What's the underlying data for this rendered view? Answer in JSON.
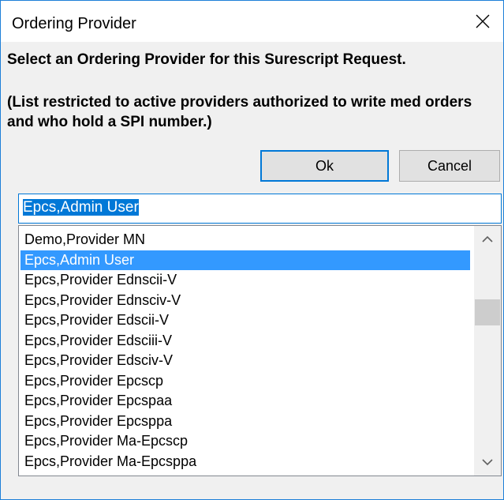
{
  "window": {
    "title": "Ordering Provider",
    "close_icon": "close-icon"
  },
  "prompt": "Select an Ordering Provider for this Surescript Request.",
  "note": "(List restricted to active providers authorized to write med orders and who hold a SPI number.)",
  "buttons": {
    "ok": "Ok",
    "cancel": "Cancel"
  },
  "search": {
    "value": "Epcs,Admin User"
  },
  "providers": [
    "Demo,Provider MN",
    "Epcs,Admin User",
    "Epcs,Provider Ednscii-V",
    "Epcs,Provider Ednsciv-V",
    "Epcs,Provider Edscii-V",
    "Epcs,Provider Edsciii-V",
    "Epcs,Provider Edsciv-V",
    "Epcs,Provider Epcscp",
    "Epcs,Provider Epcspaa",
    "Epcs,Provider Epcsppa",
    "Epcs,Provider Ma-Epcscp",
    "Epcs,Provider Ma-Epcsppa"
  ],
  "selected_index": 1,
  "scroll_icons": [
    "chevron-up-icon",
    "chevron-down-icon"
  ],
  "colors": {
    "selection": "#3399ff",
    "accent_border": "#0078d7"
  }
}
